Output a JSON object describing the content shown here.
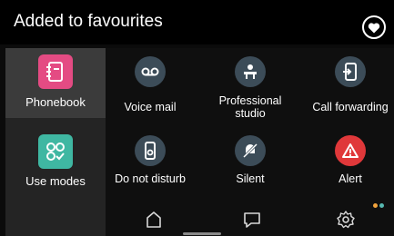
{
  "header": {
    "title": "Added to favourites",
    "fav_icon": "heart-icon"
  },
  "sidebar": {
    "items": [
      {
        "label": "Phonebook",
        "icon": "phonebook-icon",
        "color": "#e44b83",
        "active": true
      },
      {
        "label": "Use modes",
        "icon": "use-modes-icon",
        "color": "#3fb7a2",
        "active": false
      }
    ]
  },
  "tiles": [
    {
      "label": "Voice mail",
      "icon": "voicemail-icon"
    },
    {
      "label": "Professional studio",
      "icon": "studio-icon"
    },
    {
      "label": "Call forwarding",
      "icon": "call-forwarding-icon"
    },
    {
      "label": "Do not disturb",
      "icon": "do-not-disturb-icon"
    },
    {
      "label": "Silent",
      "icon": "silent-icon"
    },
    {
      "label": "Alert",
      "icon": "alert-icon"
    }
  ],
  "nav": {
    "home": "home-icon",
    "messages": "message-icon",
    "settings": "settings-icon"
  },
  "colors": {
    "accent_pink": "#e44b83",
    "accent_teal": "#3fb7a2",
    "alert_red": "#e0383a",
    "tile_circle": "#3c4c58",
    "dot_orange": "#f0a23c",
    "dot_teal": "#56b7b0"
  }
}
